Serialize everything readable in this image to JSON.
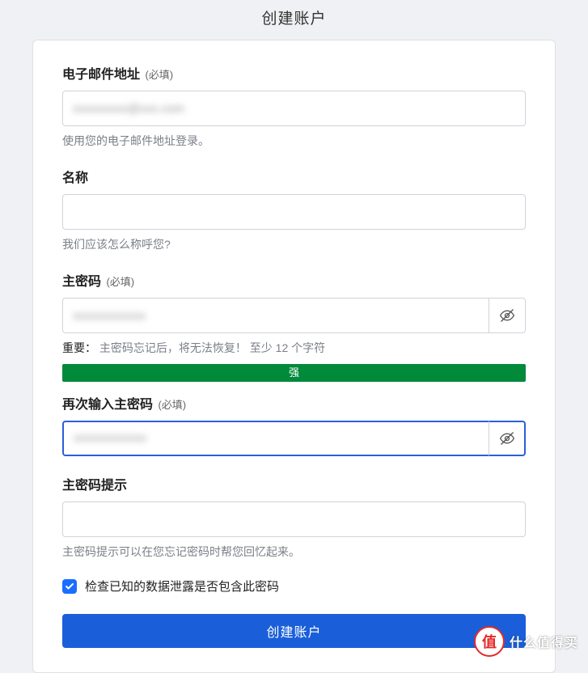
{
  "page": {
    "title": "创建账户"
  },
  "email": {
    "label": "电子邮件地址",
    "required": "(必填)",
    "value_masked": "xxxxxxxxx@xxx.com",
    "helper": "使用您的电子邮件地址登录。"
  },
  "name": {
    "label": "名称",
    "value": "",
    "helper": "我们应该怎么称呼您?"
  },
  "master_password": {
    "label": "主密码",
    "required": "(必填)",
    "value_masked": "xxxxxxxxxxxx",
    "helper_prefix": "重要：",
    "helper_text": "主密码忘记后，将无法恢复！ 至少 12 个字符",
    "strength_label": "强"
  },
  "confirm_password": {
    "label": "再次输入主密码",
    "required": "(必填)",
    "value_masked": "xxxxxxxxxxxx"
  },
  "hint": {
    "label": "主密码提示",
    "value": "",
    "helper": "主密码提示可以在您忘记密码时帮您回忆起来。"
  },
  "breach_check": {
    "label": "检查已知的数据泄露是否包含此密码",
    "checked": true
  },
  "submit": {
    "label": "创建账户"
  },
  "watermark": {
    "badge": "值",
    "text": "什么值得买"
  }
}
